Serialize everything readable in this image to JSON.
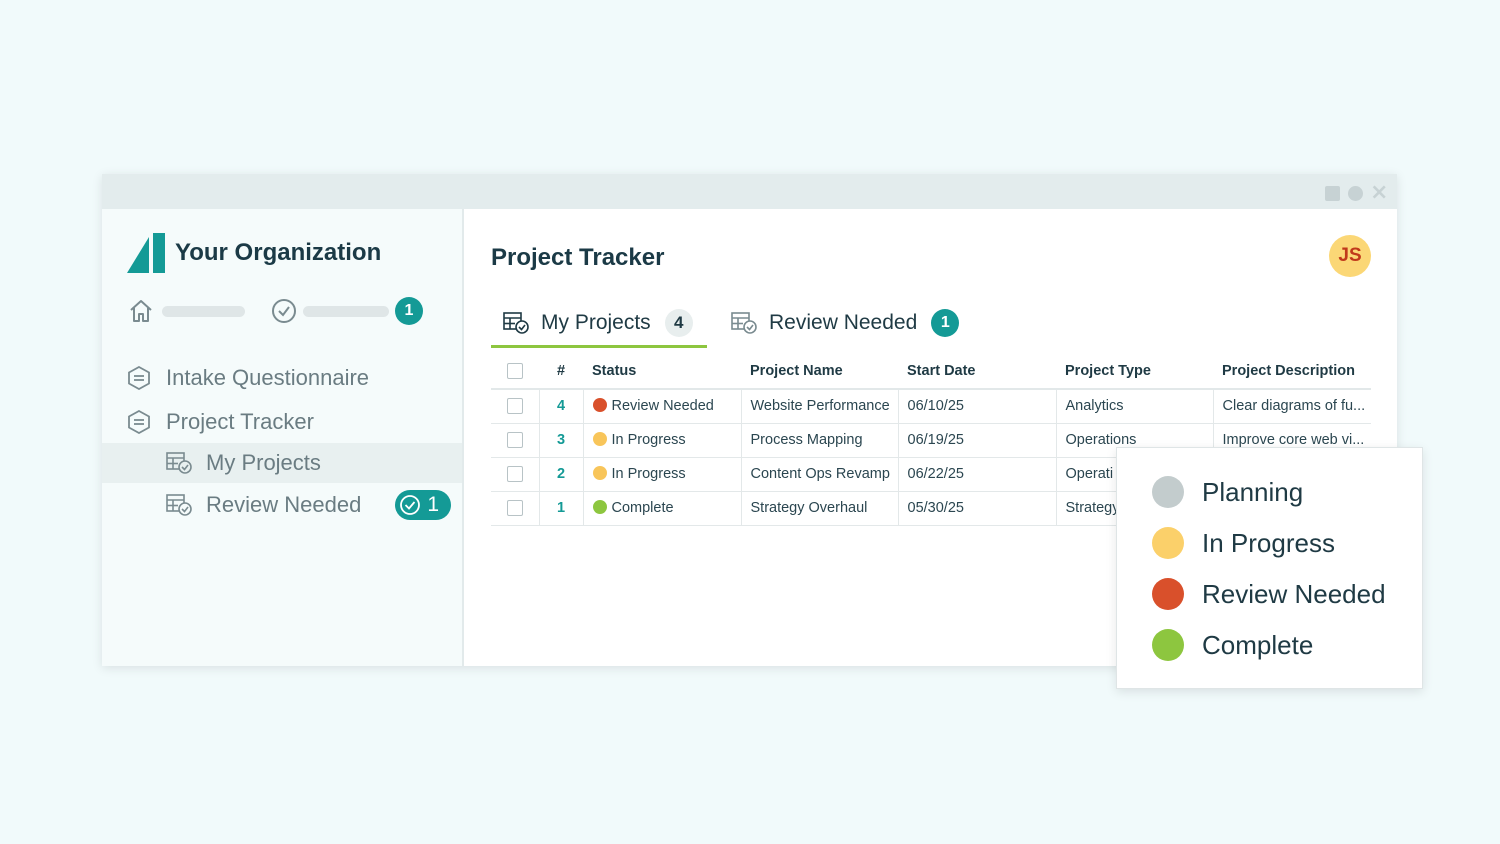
{
  "organization": {
    "name": "Your Organization",
    "logo_color": "#149a96"
  },
  "quick_bar": {
    "home_icon": "home-icon",
    "check_icon": "check-circle-icon",
    "badge_count": "1"
  },
  "sidebar": {
    "items": [
      {
        "label": "Intake Questionnaire",
        "icon": "form-icon"
      },
      {
        "label": "Project Tracker",
        "icon": "form-icon"
      },
      {
        "label": "My Projects",
        "icon": "table-check-icon",
        "active": true
      },
      {
        "label": "Review Needed",
        "icon": "table-check-icon",
        "badge": "1"
      }
    ]
  },
  "main": {
    "title": "Project Tracker",
    "avatar_initials": "JS",
    "tabs": [
      {
        "label": "My Projects",
        "count": "4",
        "active": true
      },
      {
        "label": "Review Needed",
        "count": "1"
      }
    ]
  },
  "table": {
    "columns": [
      "#",
      "Status",
      "Project Name",
      "Start Date",
      "Project Type",
      "Project Description"
    ],
    "rows": [
      {
        "num": "4",
        "status": "Review Needed",
        "status_color": "#d9502b",
        "name": "Website Performance",
        "start": "06/10/25",
        "type": "Analytics",
        "desc": "Clear diagrams of fu..."
      },
      {
        "num": "3",
        "status": "In Progress",
        "status_color": "#f8c55a",
        "name": "Process Mapping",
        "start": "06/19/25",
        "type": "Operations",
        "desc": "Improve core web vi..."
      },
      {
        "num": "2",
        "status": "In Progress",
        "status_color": "#f8c55a",
        "name": "Content Ops Revamp",
        "start": "06/22/25",
        "type": "Operati",
        "desc": ""
      },
      {
        "num": "1",
        "status": "Complete",
        "status_color": "#8dc63f",
        "name": "Strategy Overhaul",
        "start": "05/30/25",
        "type": "Strategy",
        "desc": ""
      }
    ]
  },
  "legend": [
    {
      "label": "Planning",
      "color": "#c3cccd"
    },
    {
      "label": "In Progress",
      "color": "#fbd06a"
    },
    {
      "label": "Review Needed",
      "color": "#d9502b"
    },
    {
      "label": "Complete",
      "color": "#8dc63f"
    }
  ]
}
